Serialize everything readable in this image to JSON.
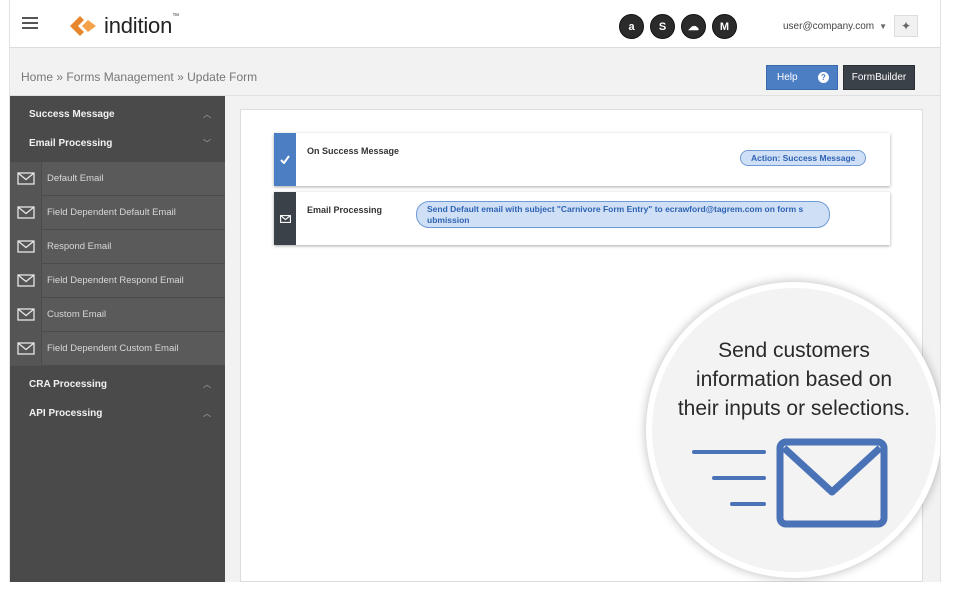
{
  "app": {
    "name": "indition",
    "tm": "™"
  },
  "integrations": [
    {
      "icon": "amazon-icon",
      "glyph": "a"
    },
    {
      "icon": "shopify-icon",
      "glyph": "S"
    },
    {
      "icon": "salesforce-icon",
      "glyph": "☁"
    },
    {
      "icon": "magento-icon",
      "glyph": "M"
    }
  ],
  "header": {
    "user_email": "user@company.com"
  },
  "breadcrumb": {
    "home": "Home",
    "sep": "»",
    "forms": "Forms Management",
    "current": "Update Form"
  },
  "buttons": {
    "help": "Help",
    "help_icon": "?",
    "formbuilder": "FormBuilder"
  },
  "sidebar": {
    "success_message": "Success Message",
    "email_processing": "Email Processing",
    "email_items": [
      "Default Email",
      "Field Dependent Default Email",
      "Respond Email",
      "Field Dependent Respond Email",
      "Custom Email",
      "Field Dependent Custom Email"
    ],
    "cra_processing": "CRA Processing",
    "api_processing": "API Processing"
  },
  "cards": {
    "success": {
      "title": "On Success Message",
      "action": "Action: Success Message",
      "stripe_color": "#4c7ec4"
    },
    "email": {
      "title": "Email Processing",
      "action_line1": "Send Default email with subject \"Carnivore Form Entry\" to ecrawford@tagrem.com on form s",
      "action_line2": "ubmission",
      "stripe_color": "#3b4149"
    }
  },
  "callout": {
    "line1": "Send customers",
    "line2": "information based on",
    "line3": "their inputs or selections.",
    "accent": "#4a72b6"
  }
}
